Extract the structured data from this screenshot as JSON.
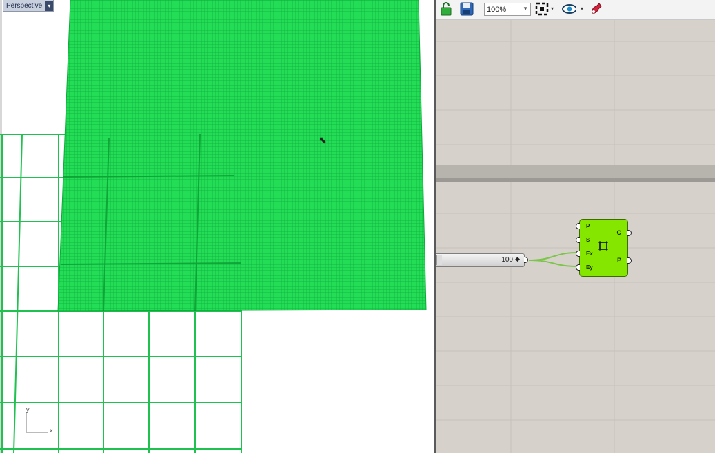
{
  "viewport": {
    "tab_label": "Perspective",
    "tab_arrow": "▾",
    "axis_y": "y",
    "axis_x": "x",
    "surface_color": "#22dd55"
  },
  "grasshopper": {
    "zoom": "100%",
    "toolbar_icons": [
      "lock-icon",
      "save-icon",
      "zoom-extents-icon",
      "preview-eye-icon",
      "bake-icon"
    ],
    "slider": {
      "value": "100",
      "diamond": "◆"
    },
    "component": {
      "name": "Rectangle",
      "inputs": [
        "P",
        "S",
        "Ex",
        "Ey"
      ],
      "outputs": [
        "C",
        "P"
      ],
      "color": "#85e600"
    }
  }
}
